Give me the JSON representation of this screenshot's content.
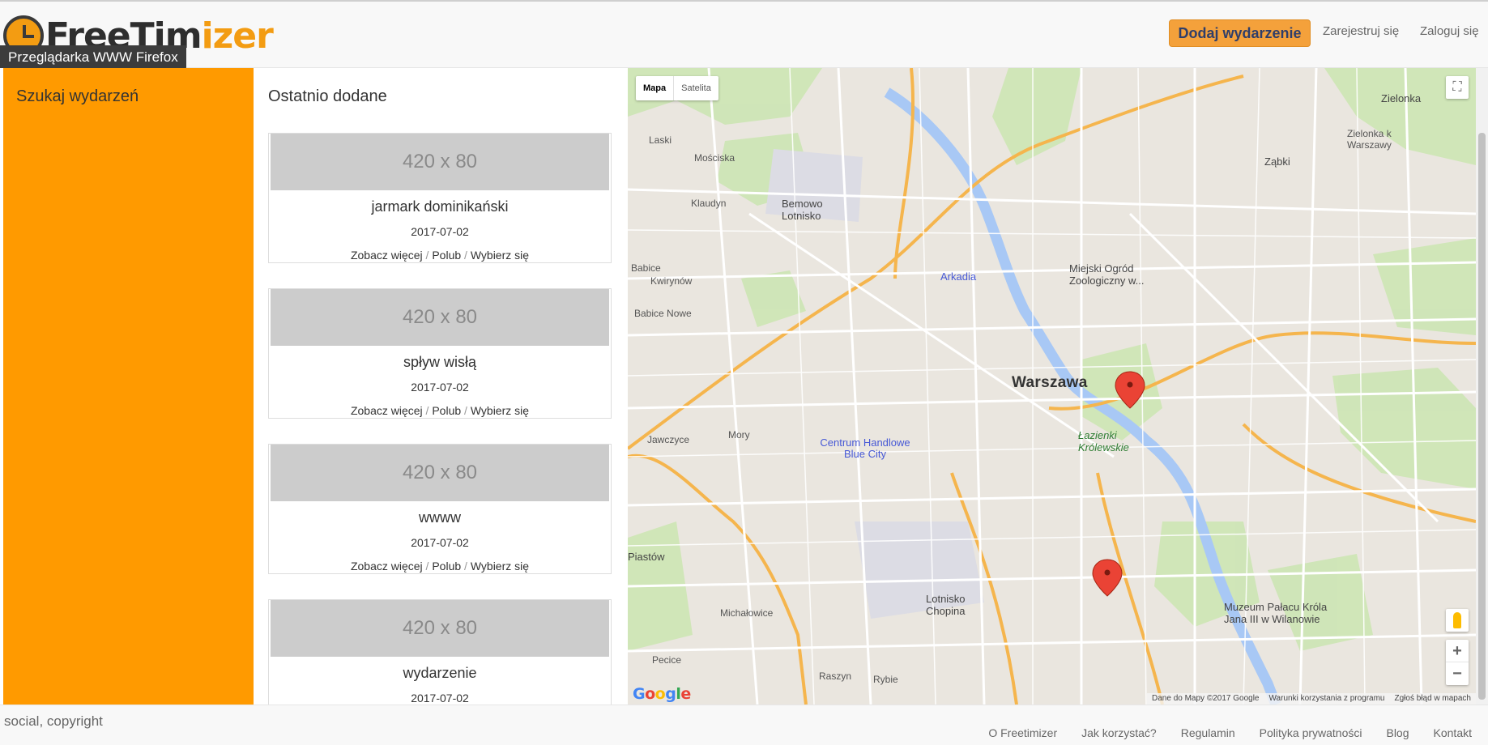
{
  "header": {
    "logo_part1": "FreeTim",
    "logo_part2": "izer",
    "tooltip": "Przeglądarka WWW Firefox",
    "add_event": "Dodaj wydarzenie",
    "register": "Zarejestruj się",
    "login": "Zaloguj się",
    "accent_color": "#ff9a00"
  },
  "sidebar": {
    "title": "Szukaj wydarzeń"
  },
  "events": {
    "title": "Ostatnio dodane",
    "links": {
      "more": "Zobacz więcej",
      "like": "Polub",
      "join": "Wybierz się",
      "sep": "/"
    },
    "items": [
      {
        "image_label": "420 x 80",
        "title": "jarmark dominikański",
        "date": "2017-07-02"
      },
      {
        "image_label": "420 x 80",
        "title": "spływ wisłą",
        "date": "2017-07-02"
      },
      {
        "image_label": "420 x 80",
        "title": "wwww",
        "date": "2017-07-02"
      },
      {
        "image_label": "420 x 80",
        "title": "wydarzenie",
        "date": "2017-07-02"
      }
    ]
  },
  "map": {
    "type_map": "Mapa",
    "type_satellite": "Satelita",
    "google": "Google",
    "attribution": [
      "Dane do Mapy ©2017 Google",
      "Warunki korzystania z programu",
      "Zgłoś błąd w mapach"
    ],
    "labels": {
      "warszawa": "Warszawa",
      "arkadia": "Arkadia",
      "zoo": "Miejski Ogród Zoologiczny w...",
      "lazienki": "Łazienki Królewskie",
      "bluecity": "Centrum Handlowe Blue City",
      "chopin": "Lotnisko Chopina",
      "wilanow": "Muzeum Pałacu Króla Jana III w Wilanowie",
      "bemowo": "Bemowo Lotnisko",
      "zielonka": "Zielonka",
      "zielonkak": "Zielonka k Warszawy",
      "zabki": "Ząbki",
      "laski": "Laski",
      "mosciska": "Mościska",
      "klaudyn": "Klaudyn",
      "babice": "Babice",
      "kwirynow": "Kwirynów",
      "babicenowe": "Babice Nowe",
      "jawczyce": "Jawczyce",
      "mory": "Mory",
      "piastow": "Piastów",
      "michalowice": "Michałowice",
      "pecice": "Pecice",
      "raszyn": "Raszyn",
      "rybie": "Rybie"
    }
  },
  "footer": {
    "left": "social, copyright",
    "links": [
      "O Freetimizer",
      "Jak korzystać?",
      "Regulamin",
      "Polityka prywatności",
      "Blog",
      "Kontakt"
    ]
  }
}
